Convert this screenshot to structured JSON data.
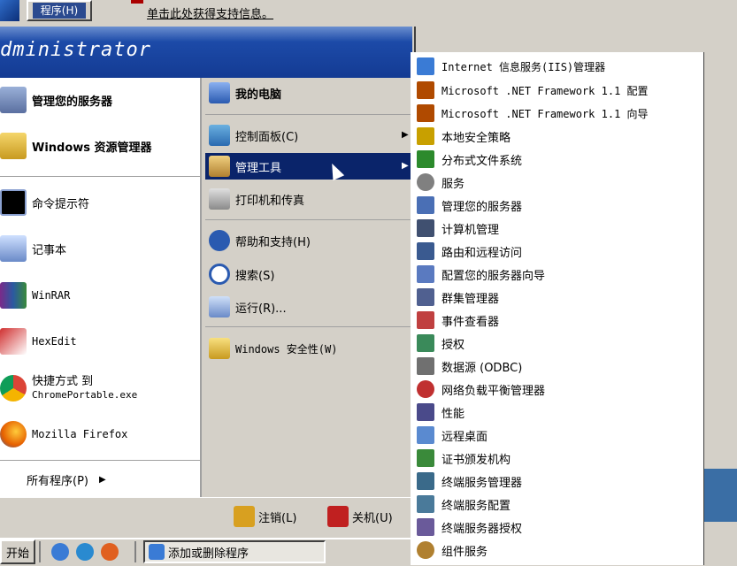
{
  "top": {
    "program_button": "程序(H)",
    "support_link": "单击此处获得支持信息。"
  },
  "start_menu": {
    "user": "dministrator",
    "left_items": [
      {
        "label": "管理您的服务器",
        "icon": "server-icon"
      },
      {
        "label": "Windows 资源管理器",
        "icon": "explorer-icon"
      },
      {
        "label": "命令提示符",
        "icon": "cmd-icon"
      },
      {
        "label": "记事本",
        "icon": "notepad-icon"
      },
      {
        "label": "WinRAR",
        "icon": "winrar-icon"
      },
      {
        "label": "HexEdit",
        "icon": "hexedit-icon"
      },
      {
        "label": "快捷方式 到",
        "sub": "ChromePortable.exe",
        "icon": "chrome-icon"
      },
      {
        "label": "Mozilla Firefox",
        "icon": "firefox-icon"
      }
    ],
    "all_programs": "所有程序(P)",
    "right_items": [
      {
        "label": "我的电脑",
        "icon": "computer-icon"
      },
      {
        "label": "控制面板(C)",
        "icon": "control-panel-icon"
      },
      {
        "label": "管理工具",
        "icon": "admin-tools-icon"
      },
      {
        "label": "打印机和传真",
        "icon": "printer-icon"
      },
      {
        "label": "帮助和支持(H)",
        "icon": "help-icon"
      },
      {
        "label": "搜索(S)",
        "icon": "search-icon"
      },
      {
        "label": "运行(R)...",
        "icon": "run-icon"
      },
      {
        "label": "Windows 安全性(W)",
        "icon": "security-icon"
      }
    ],
    "logoff": "注销(L)",
    "shutdown": "关机(U)"
  },
  "submenu": [
    {
      "label": "Internet 信息服务(IIS)管理器",
      "color": "#3a7bd5"
    },
    {
      "label": "Microsoft .NET Framework 1.1 配置",
      "color": "#b04a00"
    },
    {
      "label": "Microsoft .NET Framework 1.1 向导",
      "color": "#b04a00"
    },
    {
      "label": "本地安全策略",
      "color": "#c8a000"
    },
    {
      "label": "分布式文件系统",
      "color": "#2c8a2c"
    },
    {
      "label": "服务",
      "color": "#808080"
    },
    {
      "label": "管理您的服务器",
      "color": "#4a6fb5"
    },
    {
      "label": "计算机管理",
      "color": "#405070"
    },
    {
      "label": "路由和远程访问",
      "color": "#3a5a90"
    },
    {
      "label": "配置您的服务器向导",
      "color": "#5a7ac0"
    },
    {
      "label": "群集管理器",
      "color": "#506090"
    },
    {
      "label": "事件查看器",
      "color": "#c04040"
    },
    {
      "label": "授权",
      "color": "#3a8a5a"
    },
    {
      "label": "数据源 (ODBC)",
      "color": "#707070"
    },
    {
      "label": "网络负载平衡管理器",
      "color": "#c03030"
    },
    {
      "label": "性能",
      "color": "#4a4a8a"
    },
    {
      "label": "远程桌面",
      "color": "#5a8ad0"
    },
    {
      "label": "证书颁发机构",
      "color": "#3a8a3a"
    },
    {
      "label": "终端服务管理器",
      "color": "#3a6a8a"
    },
    {
      "label": "终端服务配置",
      "color": "#4a7a9a"
    },
    {
      "label": "终端服务器授权",
      "color": "#6a5a9a"
    },
    {
      "label": "组件服务",
      "color": "#b08030"
    }
  ],
  "taskbar": {
    "start": "开始",
    "task": "添加或删除程序"
  }
}
